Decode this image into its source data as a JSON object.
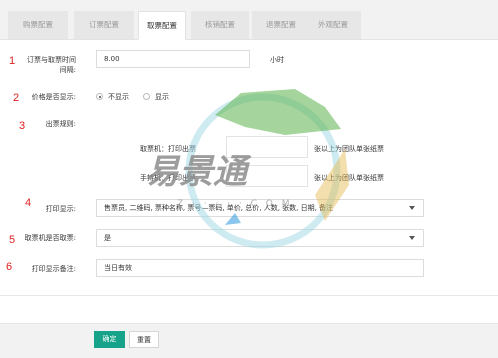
{
  "tabs": [
    {
      "label": "购票配置",
      "active": false
    },
    {
      "label": "订票配置",
      "active": false
    },
    {
      "label": "取票配置",
      "active": true
    },
    {
      "label": "核销配置",
      "active": false
    },
    {
      "label": "退票配置",
      "active": false
    },
    {
      "label": "外观配置",
      "active": false
    }
  ],
  "annotations": [
    "1",
    "2",
    "3",
    "4",
    "5",
    "6"
  ],
  "form": {
    "interval": {
      "label_line1": "订票与取票时间",
      "label_line2": "间隔:",
      "value": "8.00",
      "unit": "小时"
    },
    "show_price": {
      "label": "价格是否显示:",
      "options": [
        "不显示",
        "显示"
      ],
      "selected": "不显示"
    },
    "rules": {
      "label": "出票规则:",
      "row1_left": "取票机：打印出票",
      "row1_right": "张以上为团队单张纸票",
      "row2_left": "手持机：打印出票",
      "row2_right": "张以上为团队单张纸票"
    },
    "print_display": {
      "label": "打印显示:",
      "value": "售票员, 二维码, 票种名称, 票号—票码, 单价, 总价, 人数, 张数, 日期, 备注"
    },
    "kiosk": {
      "label": "取票机是否取票:",
      "value": "是"
    },
    "print_note": {
      "label": "打印显示备注:",
      "value": "当日有效"
    }
  },
  "watermark": {
    "text": "易景通",
    "sub": "Z · · · · · C O M"
  },
  "footer": {
    "confirm": "确定",
    "reset": "重置"
  },
  "colors": {
    "primary": "#16a389",
    "annotation": "#e02020"
  }
}
